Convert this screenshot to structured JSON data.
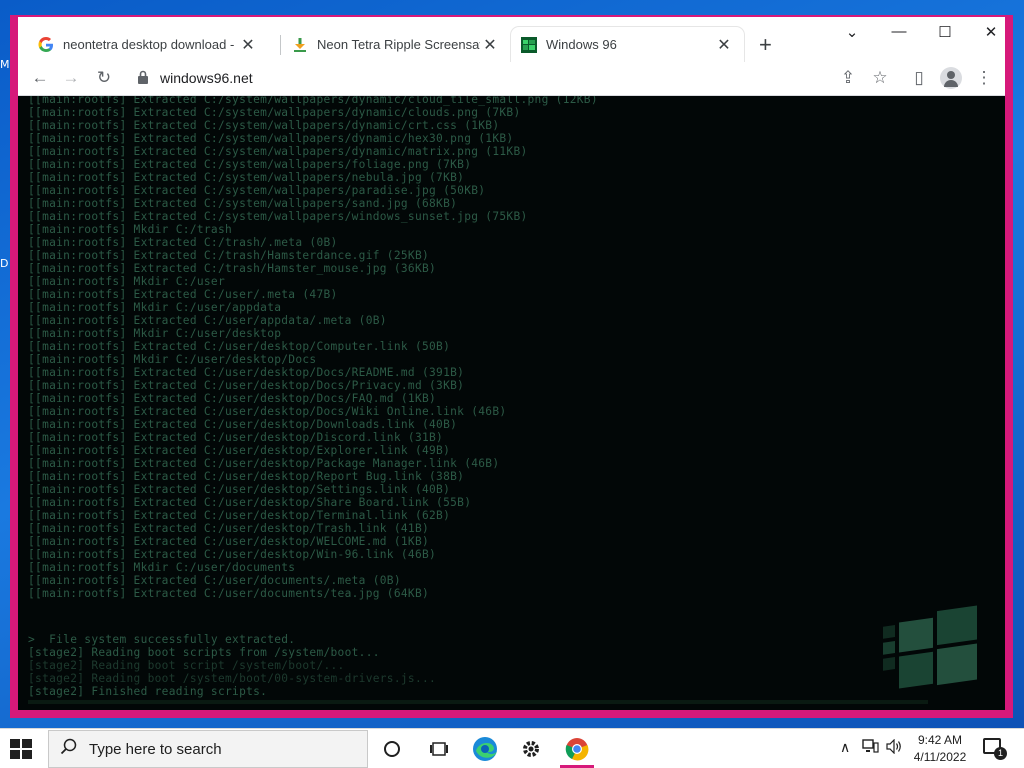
{
  "desktop": {
    "peek_letters": [
      "M",
      "D"
    ]
  },
  "browser": {
    "tabs": [
      {
        "title": "neontetra desktop download - Di",
        "favicon": "google-icon",
        "active": false
      },
      {
        "title": "Neon Tetra Ripple Screensaver (F",
        "favicon": "download-site-icon",
        "active": false
      },
      {
        "title": "Windows 96",
        "favicon": "windows96-icon",
        "active": true
      }
    ],
    "close_glyph": "✕",
    "new_tab_glyph": "+",
    "window_controls": {
      "tab_search": "⌄",
      "minimize": "—",
      "maximize": "☐",
      "close": "✕"
    },
    "toolbar": {
      "back": "←",
      "forward": "→",
      "reload": "↻",
      "url": "windows96.net",
      "share": "⇪",
      "bookmark": "☆",
      "sidepanel": "▯",
      "menu": "⋮"
    }
  },
  "terminal": {
    "lines": [
      "[[main:rootfs] Extracted C:/system/wallpapers/dynamic/cloud_tile_small.png (12KB)",
      "[[main:rootfs] Extracted C:/system/wallpapers/dynamic/clouds.png (7KB)",
      "[[main:rootfs] Extracted C:/system/wallpapers/dynamic/crt.css (1KB)",
      "[[main:rootfs] Extracted C:/system/wallpapers/dynamic/hex30.png (1KB)",
      "[[main:rootfs] Extracted C:/system/wallpapers/dynamic/matrix.png (11KB)",
      "[[main:rootfs] Extracted C:/system/wallpapers/foliage.png (7KB)",
      "[[main:rootfs] Extracted C:/system/wallpapers/nebula.jpg (7KB)",
      "[[main:rootfs] Extracted C:/system/wallpapers/paradise.jpg (50KB)",
      "[[main:rootfs] Extracted C:/system/wallpapers/sand.jpg (68KB)",
      "[[main:rootfs] Extracted C:/system/wallpapers/windows_sunset.jpg (75KB)",
      "[[main:rootfs] Mkdir C:/trash",
      "[[main:rootfs] Extracted C:/trash/.meta (0B)",
      "[[main:rootfs] Extracted C:/trash/Hamsterdance.gif (25KB)",
      "[[main:rootfs] Extracted C:/trash/Hamster_mouse.jpg (36KB)",
      "[[main:rootfs] Mkdir C:/user",
      "[[main:rootfs] Extracted C:/user/.meta (47B)",
      "[[main:rootfs] Mkdir C:/user/appdata",
      "[[main:rootfs] Extracted C:/user/appdata/.meta (0B)",
      "[[main:rootfs] Mkdir C:/user/desktop",
      "[[main:rootfs] Extracted C:/user/desktop/Computer.link (50B)",
      "[[main:rootfs] Mkdir C:/user/desktop/Docs",
      "[[main:rootfs] Extracted C:/user/desktop/Docs/README.md (391B)",
      "[[main:rootfs] Extracted C:/user/desktop/Docs/Privacy.md (3KB)",
      "[[main:rootfs] Extracted C:/user/desktop/Docs/FAQ.md (1KB)",
      "[[main:rootfs] Extracted C:/user/desktop/Docs/Wiki Online.link (46B)",
      "[[main:rootfs] Extracted C:/user/desktop/Downloads.link (40B)",
      "[[main:rootfs] Extracted C:/user/desktop/Discord.link (31B)",
      "[[main:rootfs] Extracted C:/user/desktop/Explorer.link (49B)",
      "[[main:rootfs] Extracted C:/user/desktop/Package Manager.link (46B)",
      "[[main:rootfs] Extracted C:/user/desktop/Report Bug.link (38B)",
      "[[main:rootfs] Extracted C:/user/desktop/Settings.link (40B)",
      "[[main:rootfs] Extracted C:/user/desktop/Share Board.link (55B)",
      "[[main:rootfs] Extracted C:/user/desktop/Terminal.link (62B)",
      "[[main:rootfs] Extracted C:/user/desktop/Trash.link (41B)",
      "[[main:rootfs] Extracted C:/user/desktop/WELCOME.md (1KB)",
      "[[main:rootfs] Extracted C:/user/desktop/Win-96.link (46B)",
      "[[main:rootfs] Mkdir C:/user/documents",
      "[[main:rootfs] Extracted C:/user/documents/.meta (0B)",
      "[[main:rootfs] Extracted C:/user/documents/tea.jpg (64KB)"
    ],
    "tail_lines": [
      {
        "text": ">  File system successfully extracted.",
        "style": "normal"
      },
      {
        "text": "[stage2] Reading boot scripts from /system/boot...",
        "style": "normal"
      },
      {
        "text": "[stage2] Reading boot script /system/boot/...",
        "style": "faint"
      },
      {
        "text": "[stage2] Reading boot /system/boot/00-system-drivers.js...",
        "style": "faint"
      },
      {
        "text": "[stage2] Finished reading scripts.",
        "style": "normal"
      }
    ],
    "progress_fraction": 0.0
  },
  "taskbar": {
    "search_placeholder": "Type here to search",
    "clock_time": "9:42 AM",
    "clock_date": "4/11/2022",
    "notification_count": "1",
    "tray": {
      "chevron": "∧",
      "network": "🖧",
      "volume": "🔈"
    }
  },
  "colors": {
    "accent": "#d6197a",
    "terminal_text": "#2c5a46",
    "terminal_bg": "#020707"
  }
}
